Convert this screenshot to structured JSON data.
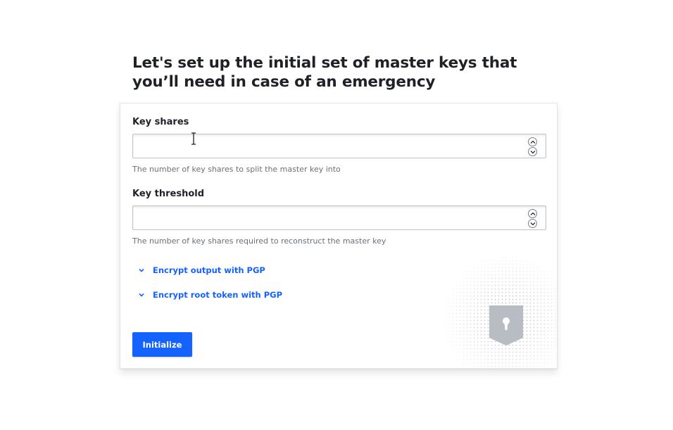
{
  "heading": "Let's set up the initial set of master keys that you’ll need in case of an emergency",
  "fields": [
    {
      "label": "Key shares",
      "value": "",
      "help": "The number of key shares to split the master key into"
    },
    {
      "label": "Key threshold",
      "value": "",
      "help": "The number of key shares required to reconstruct the master key"
    }
  ],
  "toggles": [
    {
      "label": "Encrypt output with PGP",
      "icon": "chevron-down-icon"
    },
    {
      "label": "Encrypt root token with PGP",
      "icon": "chevron-down-icon"
    }
  ],
  "submit_label": "Initialize",
  "colors": {
    "accent": "#1563ff",
    "text": "#1f2126",
    "muted": "#6a7078",
    "shield": "#b8bcc3"
  },
  "icons": {
    "stepper_up": "chevron-up-icon",
    "stepper_down": "chevron-down-icon",
    "decor": "shield-keyhole-icon"
  }
}
